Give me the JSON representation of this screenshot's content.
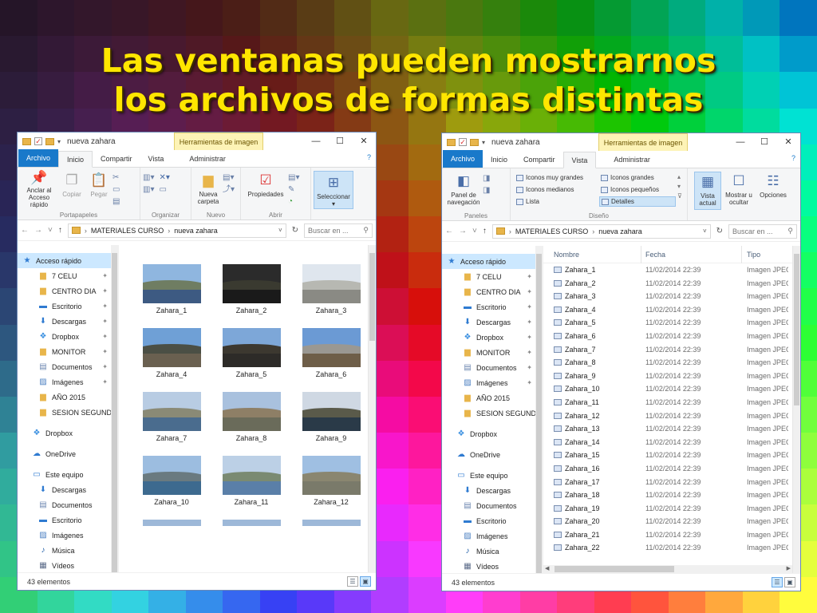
{
  "slide_title_line1": "Las ventanas pueden mostrarnos",
  "slide_title_line2": "los archivos de formas distintas",
  "colors": {
    "title": "#ffe600",
    "file_tab": "#1979ca",
    "context_tab": "#fdf3b6",
    "selection": "#cce8ff"
  },
  "window1": {
    "title": "nueva zahara",
    "context_tab": "Herramientas de imagen",
    "tabs": {
      "archivo": "Archivo",
      "inicio": "Inicio",
      "compartir": "Compartir",
      "vista": "Vista",
      "administrar": "Administrar"
    },
    "ribbon": {
      "pin_label": "Anclar al Acceso rápido",
      "copy_label": "Copiar",
      "paste_label": "Pegar",
      "new_folder_label": "Nueva carpeta",
      "properties_label": "Propiedades",
      "select_label": "Seleccionar",
      "groups": {
        "clipboard": "Portapapeles",
        "organize": "Organizar",
        "new": "Nuevo",
        "open": "Abrir"
      }
    },
    "address": {
      "crumb1": "MATERIALES CURSO",
      "crumb2": "nueva zahara",
      "search_placeholder": "Buscar en ..."
    },
    "nav": {
      "quick_access": "Acceso rápido",
      "pinned": [
        "7 CELU",
        "CENTRO DIA",
        "Escritorio",
        "Descargas",
        "Dropbox",
        "MONITOR",
        "Documentos",
        "Imágenes",
        "AÑO 2015",
        "SESION SEGUND"
      ],
      "dropbox": "Dropbox",
      "onedrive": "OneDrive",
      "this_pc": "Este equipo",
      "pc_items": [
        "Descargas",
        "Documentos",
        "Escritorio",
        "Imágenes",
        "Música",
        "Vídeos"
      ]
    },
    "files": [
      "Zahara_1",
      "Zahara_2",
      "Zahara_3",
      "Zahara_4",
      "Zahara_5",
      "Zahara_6",
      "Zahara_7",
      "Zahara_8",
      "Zahara_9",
      "Zahara_10",
      "Zahara_11",
      "Zahara_12"
    ],
    "status": "43 elementos"
  },
  "window2": {
    "title": "nueva zahara",
    "context_tab": "Herramientas de imagen",
    "tabs": {
      "archivo": "Archivo",
      "inicio": "Inicio",
      "compartir": "Compartir",
      "vista": "Vista",
      "administrar": "Administrar"
    },
    "ribbon": {
      "nav_pane_label": "Panel de navegación",
      "layouts": {
        "very_large": "Iconos muy grandes",
        "large": "Iconos grandes",
        "medium": "Iconos medianos",
        "small": "Iconos pequeños",
        "list": "Lista",
        "details": "Detalles"
      },
      "current_view_label": "Vista actual",
      "show_hide_label": "Mostrar u ocultar",
      "options_label": "Opciones",
      "groups": {
        "panes": "Paneles",
        "layout": "Diseño"
      }
    },
    "address": {
      "crumb1": "MATERIALES CURSO",
      "crumb2": "nueva zahara",
      "search_placeholder": "Buscar en ..."
    },
    "nav": {
      "quick_access": "Acceso rápido",
      "pinned": [
        "7 CELU",
        "CENTRO DIA",
        "Escritorio",
        "Descargas",
        "Dropbox",
        "MONITOR",
        "Documentos",
        "Imágenes",
        "AÑO 2015",
        "SESION SEGUND"
      ],
      "dropbox": "Dropbox",
      "onedrive": "OneDrive",
      "this_pc": "Este equipo",
      "pc_items": [
        "Descargas",
        "Documentos",
        "Escritorio",
        "Imágenes",
        "Música",
        "Vídeos"
      ]
    },
    "columns": {
      "name": "Nombre",
      "date": "Fecha",
      "type": "Tipo"
    },
    "rows": [
      {
        "name": "Zahara_1",
        "date": "11/02/2014 22:39",
        "type": "Imagen JPEG"
      },
      {
        "name": "Zahara_2",
        "date": "11/02/2014 22:39",
        "type": "Imagen JPEG"
      },
      {
        "name": "Zahara_3",
        "date": "11/02/2014 22:39",
        "type": "Imagen JPEG"
      },
      {
        "name": "Zahara_4",
        "date": "11/02/2014 22:39",
        "type": "Imagen JPEG"
      },
      {
        "name": "Zahara_5",
        "date": "11/02/2014 22:39",
        "type": "Imagen JPEG"
      },
      {
        "name": "Zahara_6",
        "date": "11/02/2014 22:39",
        "type": "Imagen JPEG"
      },
      {
        "name": "Zahara_7",
        "date": "11/02/2014 22:39",
        "type": "Imagen JPEG"
      },
      {
        "name": "Zahara_8",
        "date": "11/02/2014 22:39",
        "type": "Imagen JPEG"
      },
      {
        "name": "Zahara_9",
        "date": "11/02/2014 22:39",
        "type": "Imagen JPEG"
      },
      {
        "name": "Zahara_10",
        "date": "11/02/2014 22:39",
        "type": "Imagen JPEG"
      },
      {
        "name": "Zahara_11",
        "date": "11/02/2014 22:39",
        "type": "Imagen JPEG"
      },
      {
        "name": "Zahara_12",
        "date": "11/02/2014 22:39",
        "type": "Imagen JPEG"
      },
      {
        "name": "Zahara_13",
        "date": "11/02/2014 22:39",
        "type": "Imagen JPEG"
      },
      {
        "name": "Zahara_14",
        "date": "11/02/2014 22:39",
        "type": "Imagen JPEG"
      },
      {
        "name": "Zahara_15",
        "date": "11/02/2014 22:39",
        "type": "Imagen JPEG"
      },
      {
        "name": "Zahara_16",
        "date": "11/02/2014 22:39",
        "type": "Imagen JPEG"
      },
      {
        "name": "Zahara_17",
        "date": "11/02/2014 22:39",
        "type": "Imagen JPEG"
      },
      {
        "name": "Zahara_18",
        "date": "11/02/2014 22:39",
        "type": "Imagen JPEG"
      },
      {
        "name": "Zahara_19",
        "date": "11/02/2014 22:39",
        "type": "Imagen JPEG"
      },
      {
        "name": "Zahara_20",
        "date": "11/02/2014 22:39",
        "type": "Imagen JPEG"
      },
      {
        "name": "Zahara_21",
        "date": "11/02/2014 22:39",
        "type": "Imagen JPEG"
      },
      {
        "name": "Zahara_22",
        "date": "11/02/2014 22:39",
        "type": "Imagen JPEG"
      }
    ],
    "status": "43 elementos"
  }
}
